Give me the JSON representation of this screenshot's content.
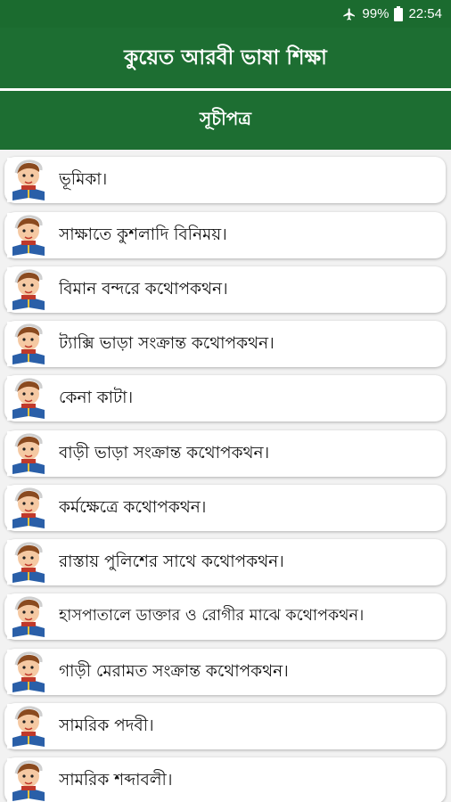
{
  "status_bar": {
    "battery": "99%",
    "time": "22:54",
    "icons": [
      "airplane-mode-icon",
      "battery-icon"
    ]
  },
  "app_title": "কুয়েত আরবী ভাষা শিক্ষা",
  "section_title": "সূচীপত্র",
  "colors": {
    "primary": "#1d6e32",
    "status_bar": "#1b6b2f",
    "list_background": "#f2f2f2",
    "card_background": "#ffffff"
  },
  "items": [
    {
      "label": "ভূমিকা।",
      "icon": "student-reading-icon"
    },
    {
      "label": "সাক্ষাতে কুশলাদি বিনিময়।",
      "icon": "student-reading-icon"
    },
    {
      "label": "বিমান বন্দরে কথোপকথন।",
      "icon": "student-reading-icon"
    },
    {
      "label": "ট্যাক্সি ভাড়া সংক্রান্ত কথোপকথন।",
      "icon": "student-reading-icon"
    },
    {
      "label": "কেনা কাটা।",
      "icon": "student-reading-icon"
    },
    {
      "label": "বাড়ী ভাড়া সংক্রান্ত কথোপকথন।",
      "icon": "student-reading-icon"
    },
    {
      "label": "কর্মক্ষেত্রে কথোপকথন।",
      "icon": "student-reading-icon"
    },
    {
      "label": "রাস্তায় পুলিশের সাথে কথোপকথন।",
      "icon": "student-reading-icon"
    },
    {
      "label": "হাসপাতালে ডাক্তার ও রোগীর মাঝে কথোপকথন।",
      "icon": "student-reading-icon"
    },
    {
      "label": "গাড়ী মেরামত সংক্রান্ত কথোপকথন।",
      "icon": "student-reading-icon"
    },
    {
      "label": "সামরিক পদবী।",
      "icon": "student-reading-icon"
    },
    {
      "label": "সামরিক শব্দাবলী।",
      "icon": "student-reading-icon"
    }
  ]
}
